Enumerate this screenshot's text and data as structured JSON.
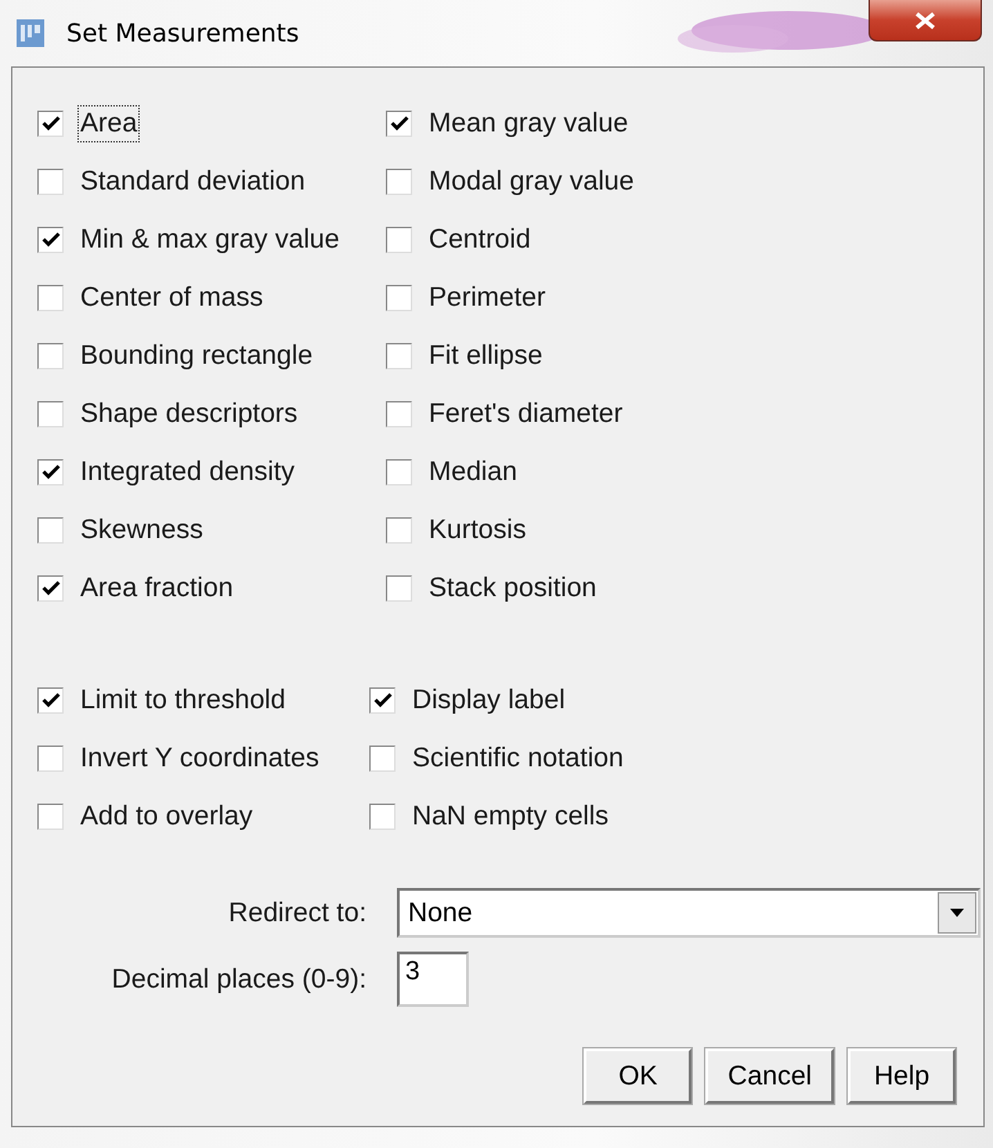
{
  "window": {
    "title": "Set Measurements"
  },
  "measurements": [
    {
      "label": "Area",
      "checked": true,
      "focused": true
    },
    {
      "label": "Mean gray value",
      "checked": true,
      "focused": false
    },
    {
      "label": "Standard deviation",
      "checked": false,
      "focused": false
    },
    {
      "label": "Modal gray value",
      "checked": false,
      "focused": false
    },
    {
      "label": "Min & max gray value",
      "checked": true,
      "focused": false
    },
    {
      "label": "Centroid",
      "checked": false,
      "focused": false
    },
    {
      "label": "Center of mass",
      "checked": false,
      "focused": false
    },
    {
      "label": "Perimeter",
      "checked": false,
      "focused": false
    },
    {
      "label": "Bounding rectangle",
      "checked": false,
      "focused": false
    },
    {
      "label": "Fit ellipse",
      "checked": false,
      "focused": false
    },
    {
      "label": "Shape descriptors",
      "checked": false,
      "focused": false
    },
    {
      "label": "Feret's diameter",
      "checked": false,
      "focused": false
    },
    {
      "label": "Integrated density",
      "checked": true,
      "focused": false
    },
    {
      "label": "Median",
      "checked": false,
      "focused": false
    },
    {
      "label": "Skewness",
      "checked": false,
      "focused": false
    },
    {
      "label": "Kurtosis",
      "checked": false,
      "focused": false
    },
    {
      "label": "Area fraction",
      "checked": true,
      "focused": false
    },
    {
      "label": "Stack position",
      "checked": false,
      "focused": false
    }
  ],
  "options": [
    {
      "label": "Limit to threshold",
      "checked": true
    },
    {
      "label": "Display label",
      "checked": true
    },
    {
      "label": "Invert Y coordinates",
      "checked": false
    },
    {
      "label": "Scientific notation",
      "checked": false
    },
    {
      "label": "Add to overlay",
      "checked": false
    },
    {
      "label": "NaN empty cells",
      "checked": false
    }
  ],
  "redirect": {
    "label": "Redirect to:",
    "value": "None"
  },
  "decimal_places": {
    "label": "Decimal places (0-9):",
    "value": "3"
  },
  "buttons": [
    "OK",
    "Cancel",
    "Help"
  ]
}
